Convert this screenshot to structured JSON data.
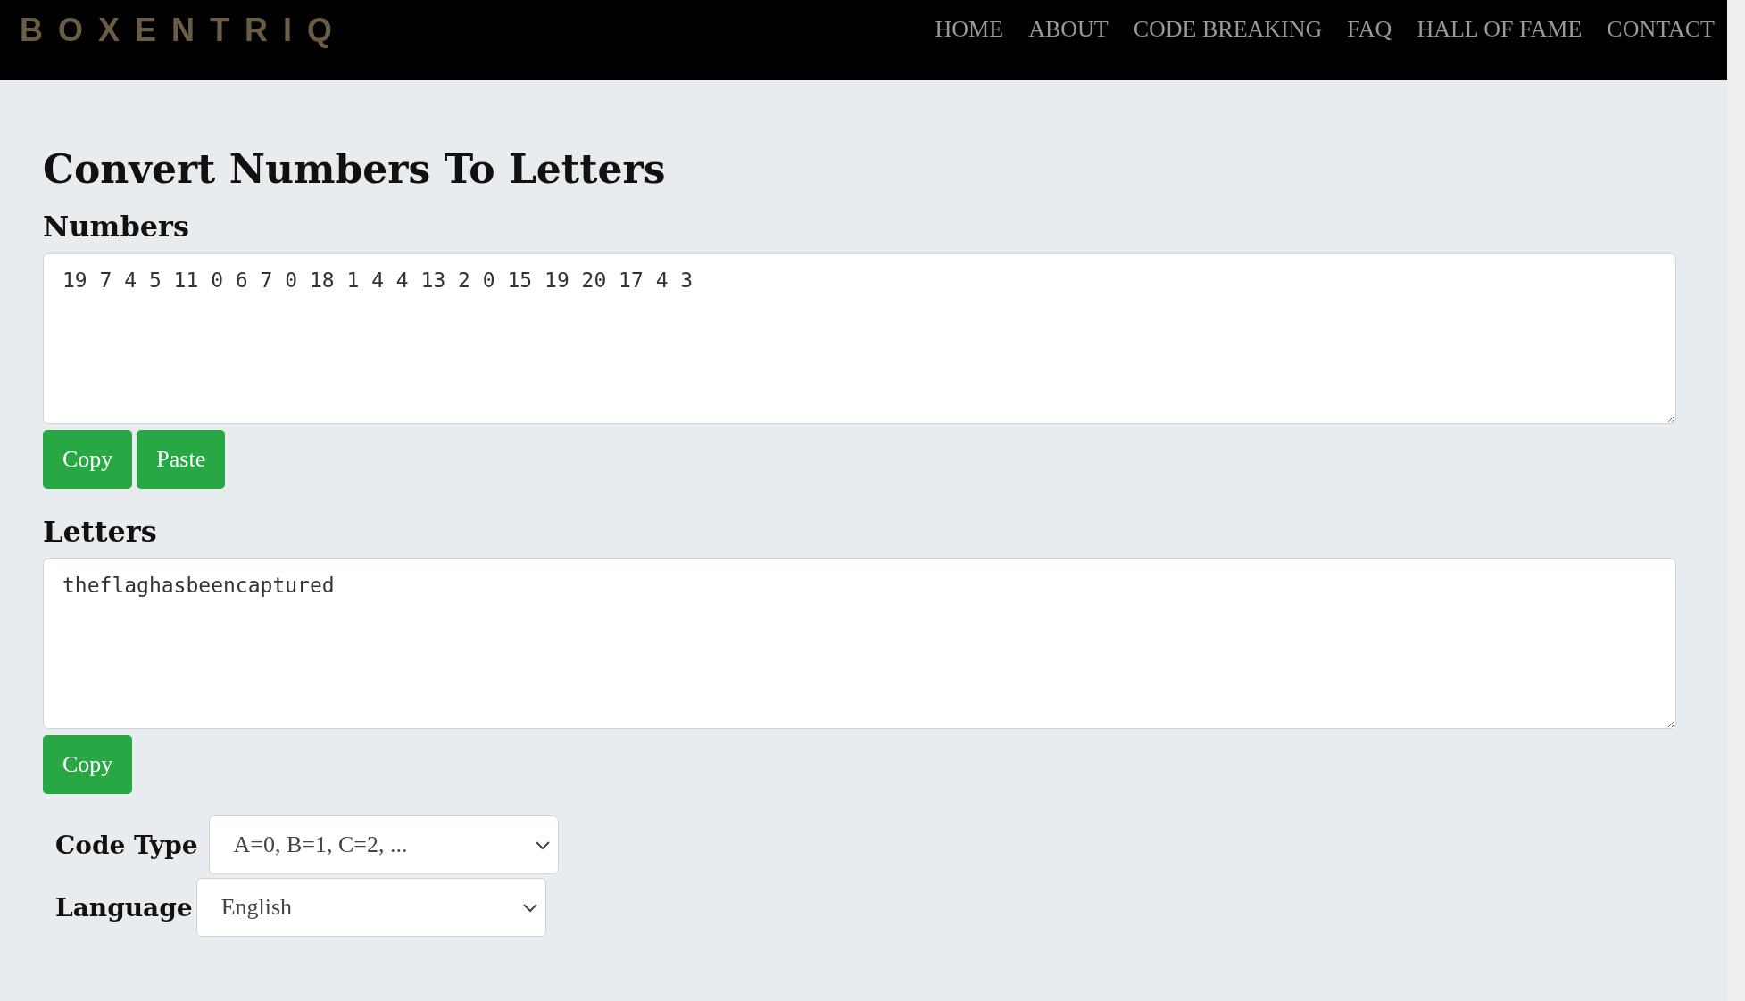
{
  "header": {
    "logo": "BOXENTRIQ",
    "nav": [
      {
        "label": "HOME"
      },
      {
        "label": "ABOUT"
      },
      {
        "label": "CODE BREAKING"
      },
      {
        "label": "FAQ"
      },
      {
        "label": "HALL OF FAME"
      },
      {
        "label": "CONTACT"
      }
    ]
  },
  "title": "Convert Numbers To Letters",
  "sections": [
    {
      "heading": "Numbers",
      "value": "19 7 4 5 11 0 6 7 0 18 1 4 4 13 2 0 15 19 20 17 4 3",
      "buttons": [
        "Copy",
        "Paste"
      ]
    },
    {
      "heading": "Letters",
      "value": "theflaghasbeencaptured",
      "buttons": [
        "Copy"
      ]
    }
  ],
  "options": [
    {
      "label": "Code Type",
      "value": "A=0, B=1, C=2, ..."
    },
    {
      "label": "Language",
      "value": "English"
    }
  ]
}
